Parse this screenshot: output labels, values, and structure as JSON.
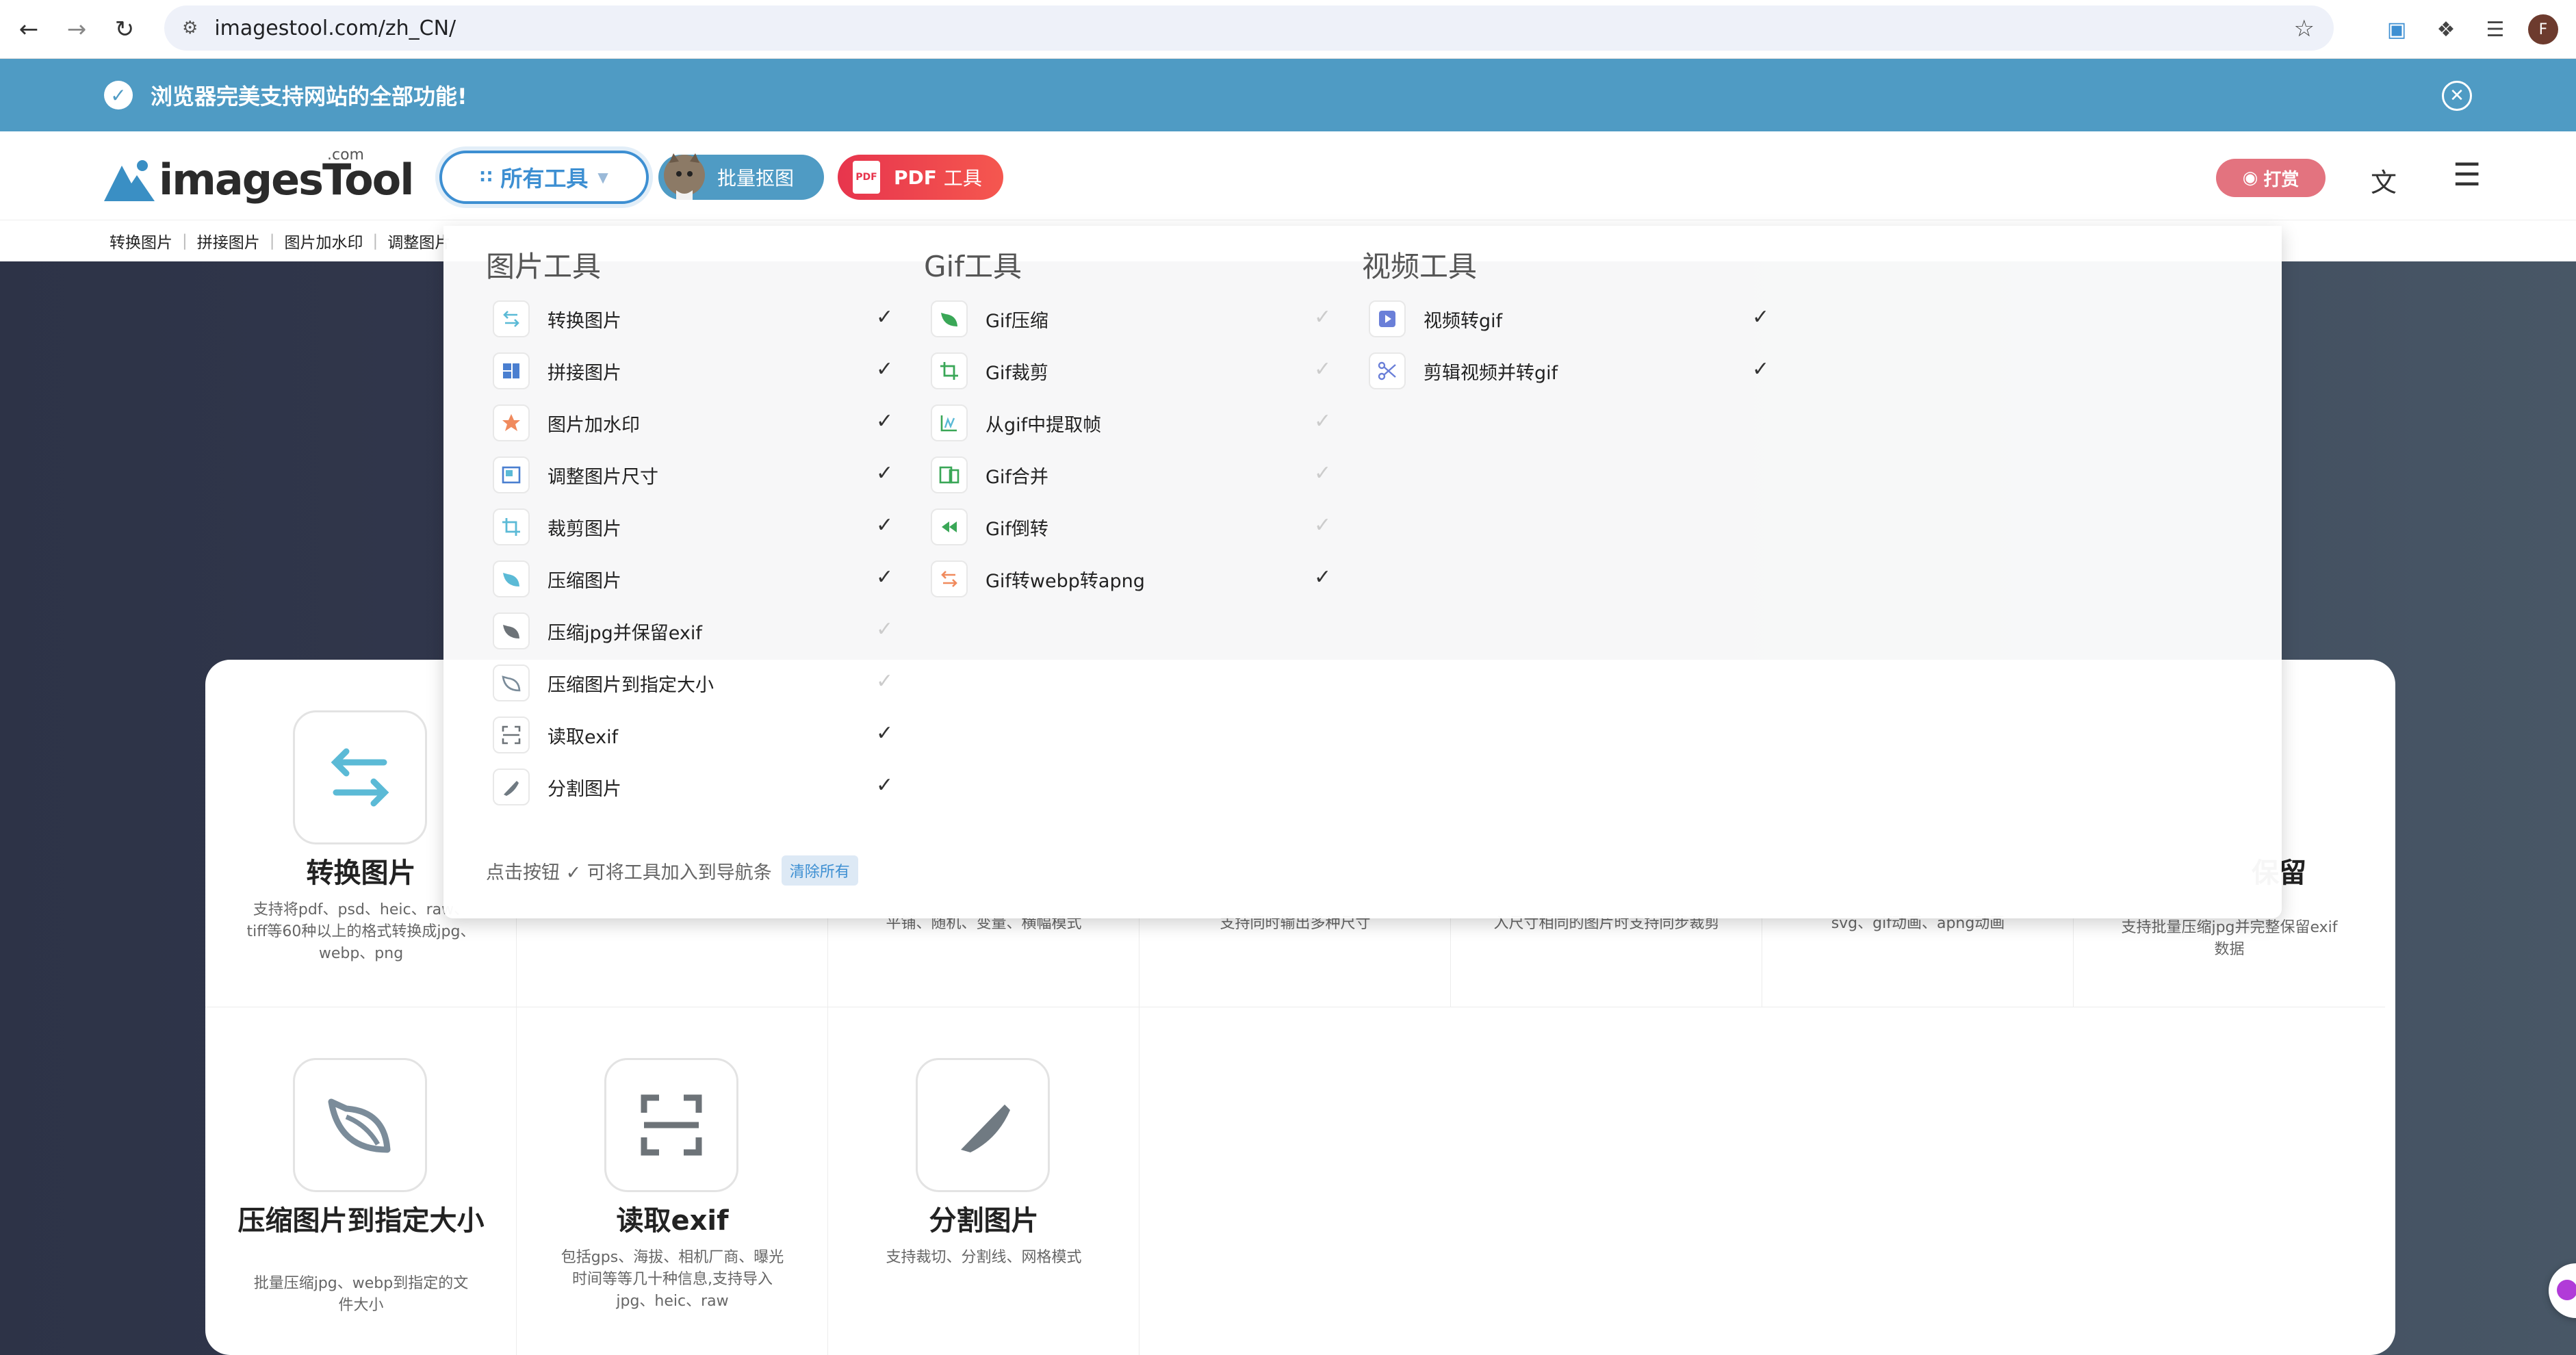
{
  "browser": {
    "url": "imagestool.com/zh_CN/",
    "profile_initial": "F"
  },
  "notice": {
    "text": "浏览器完美支持网站的全部功能!"
  },
  "header": {
    "logo_text": "imagesTool",
    "logo_com": ".com",
    "all_tools_label": "所有工具",
    "batch_label": "批量抠图",
    "pdf_label": "PDF",
    "pdf_label_suffix": "工具",
    "donate_label": "打赏",
    "pdf_icon_text": "PDF"
  },
  "breadcrumbs": [
    "转换图片",
    "拼接图片",
    "图片加水印",
    "调整图片"
  ],
  "mega_menu": {
    "columns": [
      {
        "title": "图片工具",
        "items": [
          {
            "label": "转换图片",
            "checked": true
          },
          {
            "label": "拼接图片",
            "checked": true
          },
          {
            "label": "图片加水印",
            "checked": true
          },
          {
            "label": "调整图片尺寸",
            "checked": true
          },
          {
            "label": "裁剪图片",
            "checked": true
          },
          {
            "label": "压缩图片",
            "checked": true
          },
          {
            "label": "压缩jpg并保留exif",
            "checked": false
          },
          {
            "label": "压缩图片到指定大小",
            "checked": false
          },
          {
            "label": "读取exif",
            "checked": true
          },
          {
            "label": "分割图片",
            "checked": true
          }
        ]
      },
      {
        "title": "Gif工具",
        "items": [
          {
            "label": "Gif压缩",
            "checked": false
          },
          {
            "label": "Gif裁剪",
            "checked": false
          },
          {
            "label": "从gif中提取帧",
            "checked": false
          },
          {
            "label": "Gif合并",
            "checked": false
          },
          {
            "label": "Gif倒转",
            "checked": false
          },
          {
            "label": "Gif转webp转apng",
            "checked": true
          }
        ]
      },
      {
        "title": "视频工具",
        "items": [
          {
            "label": "视频转gif",
            "checked": true
          },
          {
            "label": "剪辑视频并转gif",
            "checked": true
          }
        ]
      }
    ],
    "footer_text": "点击按钮 ✓ 可将工具加入到导航条",
    "clear_label": "清除所有"
  },
  "tool_cards": [
    {
      "name": "转换图片",
      "desc": "支持将pdf、psd、heic、raw、tiff等60种以上的格式转换成jpg、webp、png"
    },
    {
      "name": "",
      "desc": "平铺、随机、变量、横幅模式"
    },
    {
      "name": "",
      "desc": "支持同时输出多种尺寸"
    },
    {
      "name": "",
      "desc": "入尺寸相同的图片时支持同步裁剪"
    },
    {
      "name": "",
      "desc": "svg、gif动画、apng动画"
    },
    {
      "name": "保留",
      "desc": "支持批量压缩jpg并完整保留exif数据"
    },
    {
      "name": "压缩图片到指定大小",
      "desc": "批量压缩jpg、webp到指定的文件大小"
    },
    {
      "name": "读取exif",
      "desc": "包括gps、海拔、相机厂商、曝光时间等等几十种信息,支持导入jpg、heic、raw"
    },
    {
      "name": "分割图片",
      "desc": "支持裁切、分割线、网格模式"
    }
  ],
  "colors": {
    "accent_blue": "#3d8fd2",
    "notice_bg": "#4f9bc4",
    "pdf_red": "#e7354d",
    "donate_pink": "#e3737f",
    "hero_dark": "#2d3347"
  }
}
